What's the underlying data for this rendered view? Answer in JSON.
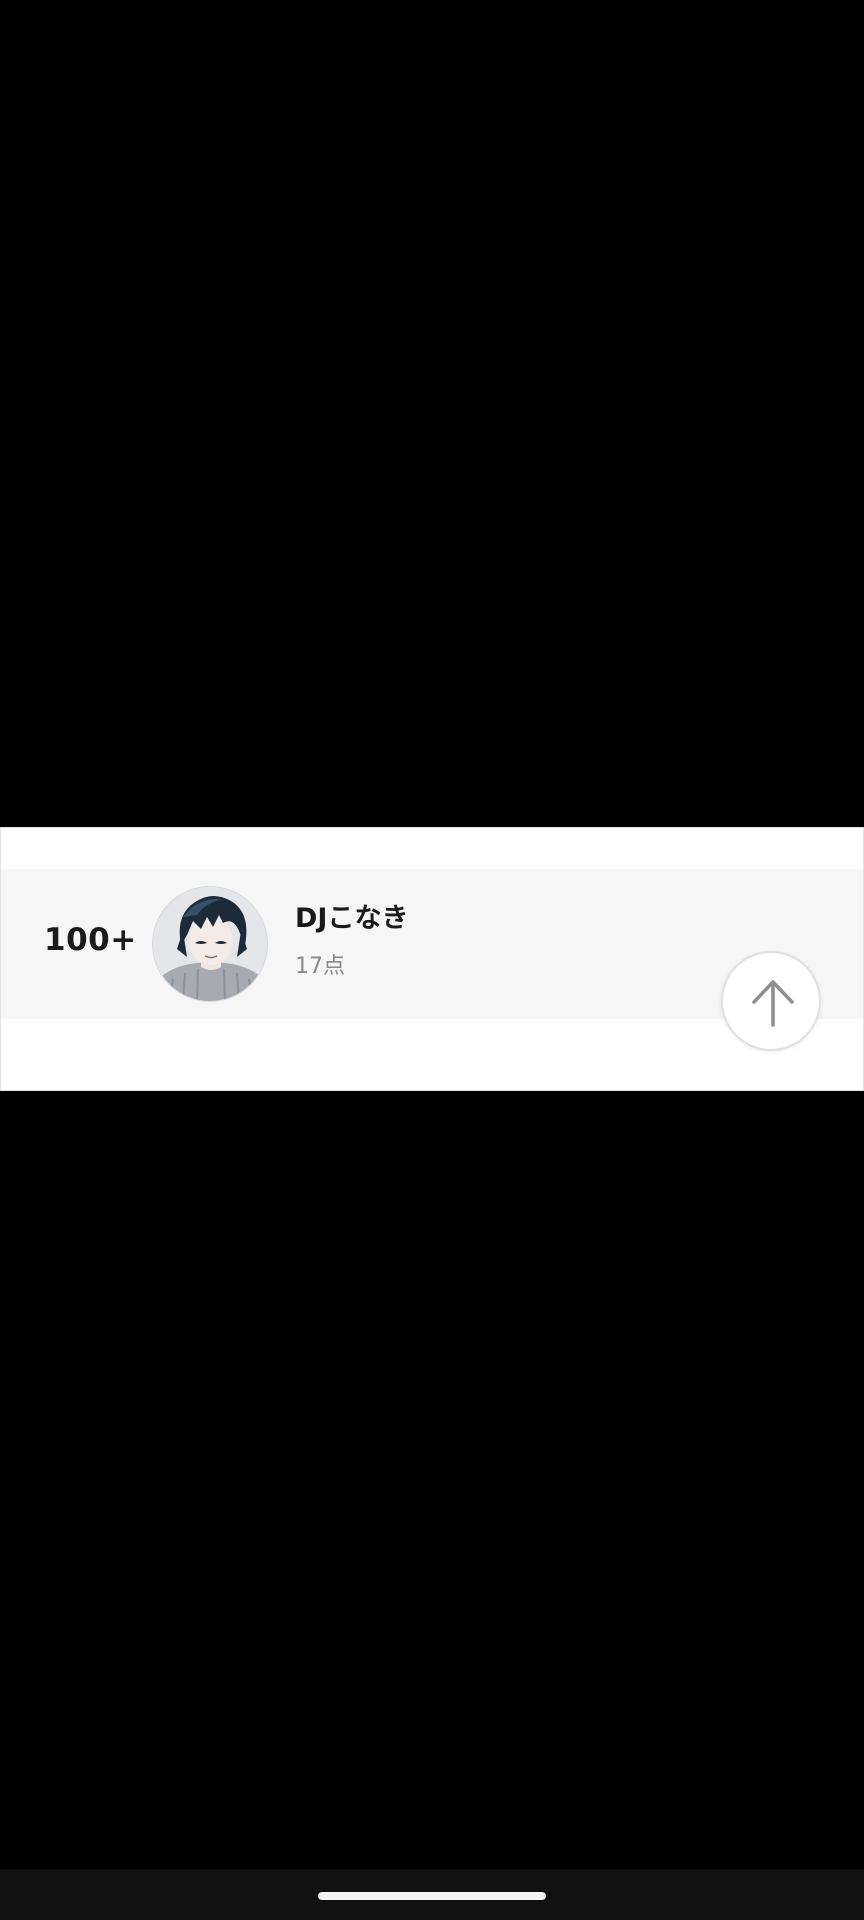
{
  "ranking": {
    "rank": "100+",
    "name": "DJこなき",
    "score": "17点"
  },
  "avatar": {
    "icon": "anime-character-avatar"
  },
  "scroll_top": {
    "icon": "arrow-up-icon"
  },
  "colors": {
    "background": "#000000",
    "card": "#ffffff",
    "row": "#f6f6f6",
    "name_text": "#1a1a1a",
    "score_text": "#8a8a8a"
  }
}
